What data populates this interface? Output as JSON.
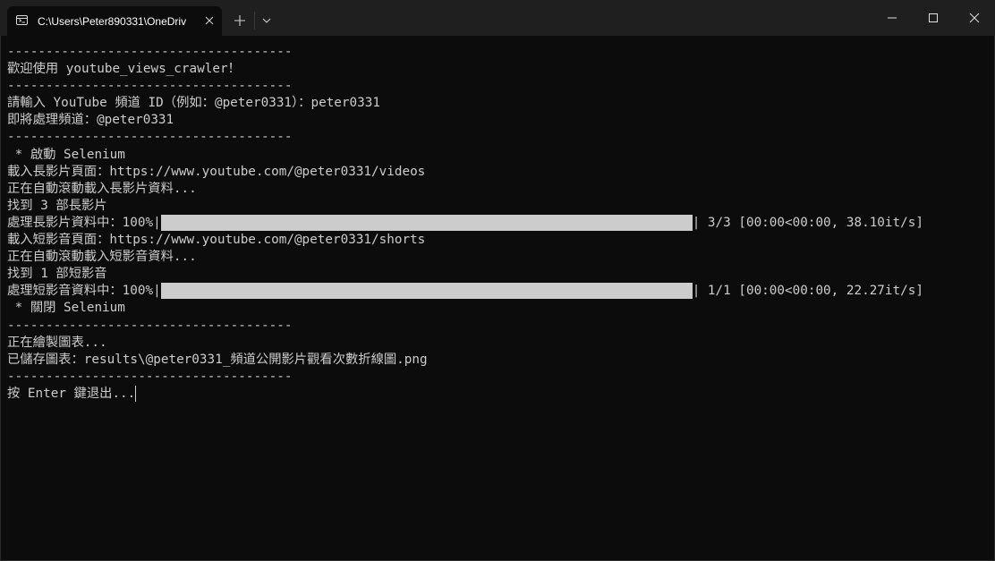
{
  "window": {
    "tab_title": "C:\\Users\\Peter890331\\OneDriv"
  },
  "terminal": {
    "lines": [
      "-------------------------------------",
      "歡迎使用 youtube_views_crawler！",
      "-------------------------------------",
      "請輸入 YouTube 頻道 ID（例如：@peter0331）：peter0331",
      "即將處理頻道：@peter0331",
      "-------------------------------------",
      " * 啟動 Selenium",
      "載入長影片頁面：https://www.youtube.com/@peter0331/videos",
      "正在自動滾動載入長影片資料...",
      "找到 3 部長影片",
      {
        "progress_prefix": "處理長影片資料中：100%|",
        "progress": 1.0,
        "progress_suffix": "| 3/3 [00:00<00:00, 38.10it/s]"
      },
      "載入短影音頁面：https://www.youtube.com/@peter0331/shorts",
      "正在自動滾動載入短影音資料...",
      "找到 1 部短影音",
      {
        "progress_prefix": "處理短影音資料中：100%|",
        "progress": 1.0,
        "progress_suffix": "| 1/1 [00:00<00:00, 22.27it/s]"
      },
      " * 關閉 Selenium",
      "-------------------------------------",
      "正在繪製圖表...",
      "已儲存圖表：results\\@peter0331_頻道公開影片觀看次數折線圖.png",
      "-------------------------------------",
      "按 Enter 鍵退出..."
    ]
  },
  "colors": {
    "background": "#0c0c0c",
    "titlebar": "#1f1f1f",
    "text": "#cccccc",
    "progress_bar": "#cccccc"
  },
  "icons": {
    "tab_icon": "terminal-icon",
    "tab_close": "close-icon",
    "new_tab": "plus-icon",
    "dropdown": "chevron-down-icon",
    "minimize": "minimize-icon",
    "maximize": "maximize-icon",
    "close": "close-icon"
  }
}
